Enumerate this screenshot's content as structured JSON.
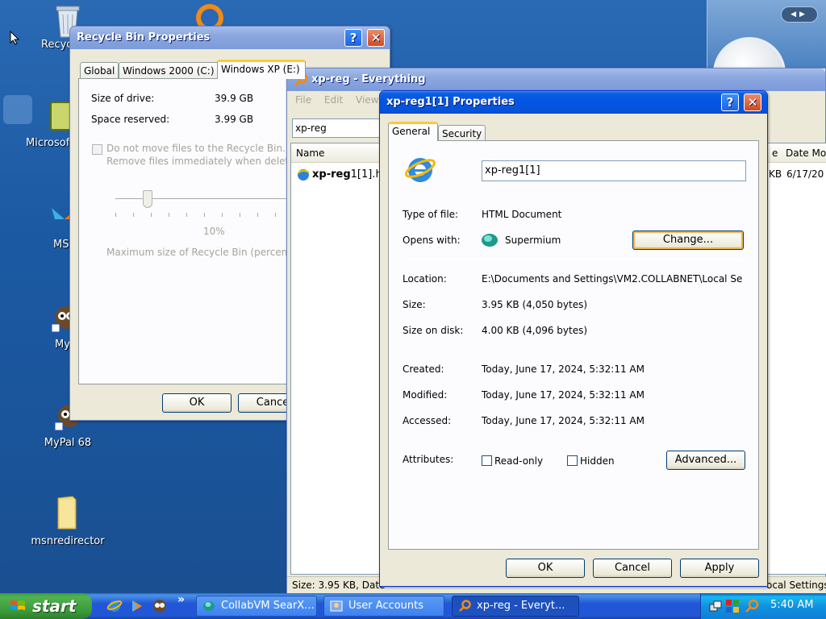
{
  "desktop": {
    "icons": [
      {
        "label": "Recyc",
        "icon": "recycle-bin-icon"
      },
      {
        "label": "Microsoft",
        "icon": "app-icon"
      },
      {
        "label": "MSN",
        "icon": "msn-butterfly-icon"
      },
      {
        "label": "My",
        "icon": "mypal-icon"
      },
      {
        "label": "MyPal 68",
        "icon": "mypal-icon"
      },
      {
        "label": "msnredirector",
        "icon": "folder-icon"
      }
    ]
  },
  "recycle_props": {
    "title": "Recycle Bin Properties",
    "help": "?",
    "close": "✕",
    "tabs": [
      "Global",
      "Windows 2000 (C:)",
      "Windows XP (E:)"
    ],
    "size_of_drive_label": "Size of drive:",
    "size_of_drive_value": "39.9 GB",
    "space_reserved_label": "Space reserved:",
    "space_reserved_value": "3.99 GB",
    "do_not_move_line1": "Do not move files to the Recycle Bin.",
    "do_not_move_line2": "Remove files immediately when deleted",
    "slider_value": "10%",
    "slider_percent": 10,
    "max_size_label": "Maximum size of Recycle Bin (percent of",
    "ok": "OK",
    "cancel": "Cance"
  },
  "everything": {
    "title": "xp-reg - Everything",
    "menu": [
      "File",
      "Edit",
      "View"
    ],
    "search_value": "xp-reg",
    "col_name": "Name",
    "col_size_partial": "e",
    "col_date": "Date Mod",
    "row_name_bold": "xp-reg",
    "row_name_rest": "1[1].h",
    "row_size_partial": "KB",
    "row_date": "6/17/20",
    "status_left": "Size: 3.95 KB, Date",
    "status_right": "ocal Settings"
  },
  "file_props": {
    "title": "xp-reg1[1] Properties",
    "help": "?",
    "close": "✕",
    "tabs": [
      "General",
      "Security"
    ],
    "filename": "xp-reg1[1]",
    "type_label": "Type of file:",
    "type_value": "HTML Document",
    "opens_label": "Opens with:",
    "opens_value": "Supermium",
    "change": "Change...",
    "location_label": "Location:",
    "location_value": "E:\\Documents and Settings\\VM2.COLLABNET\\Local Se",
    "size_label": "Size:",
    "size_value": "3.95 KB (4,050 bytes)",
    "size_disk_label": "Size on disk:",
    "size_disk_value": "4.00 KB (4,096 bytes)",
    "created_label": "Created:",
    "created_value": "Today, June 17, 2024, 5:32:11 AM",
    "modified_label": "Modified:",
    "modified_value": "Today, June 17, 2024, 5:32:11 AM",
    "accessed_label": "Accessed:",
    "accessed_value": "Today, June 17, 2024, 5:32:11 AM",
    "attributes_label": "Attributes:",
    "readonly_label": "Read-only",
    "hidden_label": "Hidden",
    "advanced": "Advanced...",
    "ok": "OK",
    "cancel": "Cancel",
    "apply": "Apply"
  },
  "taskbar": {
    "start": "start",
    "quick_launch_more": "»",
    "buttons": [
      {
        "label": "CollabVM SearX...",
        "icon": "supermium-icon",
        "active": false
      },
      {
        "label": "User Accounts",
        "icon": "user-accounts-icon",
        "active": false
      },
      {
        "label": "xp-reg - Everyt...",
        "icon": "everything-search-icon",
        "active": true
      }
    ],
    "clock": "5:40 AM"
  },
  "colors": {
    "title_active": "#0554e3",
    "title_inactive": "#7c9bd8",
    "desktop": "#1b5aa3",
    "taskbar": "#2157d7",
    "start": "#3a9a3a",
    "dialog_face": "#ece9d8"
  }
}
